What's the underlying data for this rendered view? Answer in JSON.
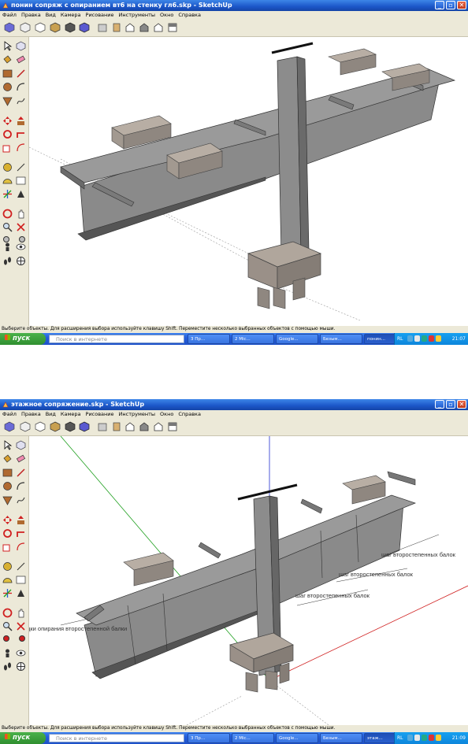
{
  "screens": [
    {
      "title": "понин сопряж с опиранием вт6 на стенку гл6.skp - SketchUp",
      "menu": [
        "Файл",
        "Правка",
        "Вид",
        "Камера",
        "Рисование",
        "Инструменты",
        "Окно",
        "Справка"
      ],
      "status": "Выберите объекты. Для расширения выбора используйте клавишу Shift. Переместите несколько выбранных объектов с помощью мыши.",
      "start_label": "пуск",
      "search_placeholder": "Поиск в интернете",
      "tasks": [
        "3 Пр...",
        "2 Mic...",
        "Google...",
        "Безым...",
        "понин..."
      ],
      "tray_lang": "RL",
      "clock": "21:07",
      "annotations": []
    },
    {
      "title": "этажное сопряжение.skp - SketchUp",
      "menu": [
        "Файл",
        "Правка",
        "Вид",
        "Камера",
        "Рисование",
        "Инструменты",
        "Окно",
        "Справка"
      ],
      "status": "Выберите объекты. Для расширения выбора используйте клавишу Shift. Переместите несколько выбранных объектов с помощью мыши.",
      "start_label": "пуск",
      "search_placeholder": "Поиск в интернете",
      "tasks": [
        "3 Пр...",
        "2 Mic...",
        "Google...",
        "Безым...",
        "этаж..."
      ],
      "tray_lang": "RL",
      "clock": "21:09",
      "annotations": [
        "шаг второстепенных балок",
        "шаг второстепенных балок",
        "шаг второстепенных балок",
        "дки опирания второстепенной балки"
      ]
    }
  ],
  "colors": {
    "titlebar": "#1b56c8",
    "taskbar": "#245edc",
    "start": "#2f8f2f",
    "chrome": "#ece9d8",
    "steel": "#8a8a8a",
    "concrete": "#a89f96"
  },
  "icons": [
    "app-icon",
    "minimize-icon",
    "maximize-icon",
    "close-icon",
    "orbit-icon",
    "windows-flag-icon"
  ]
}
